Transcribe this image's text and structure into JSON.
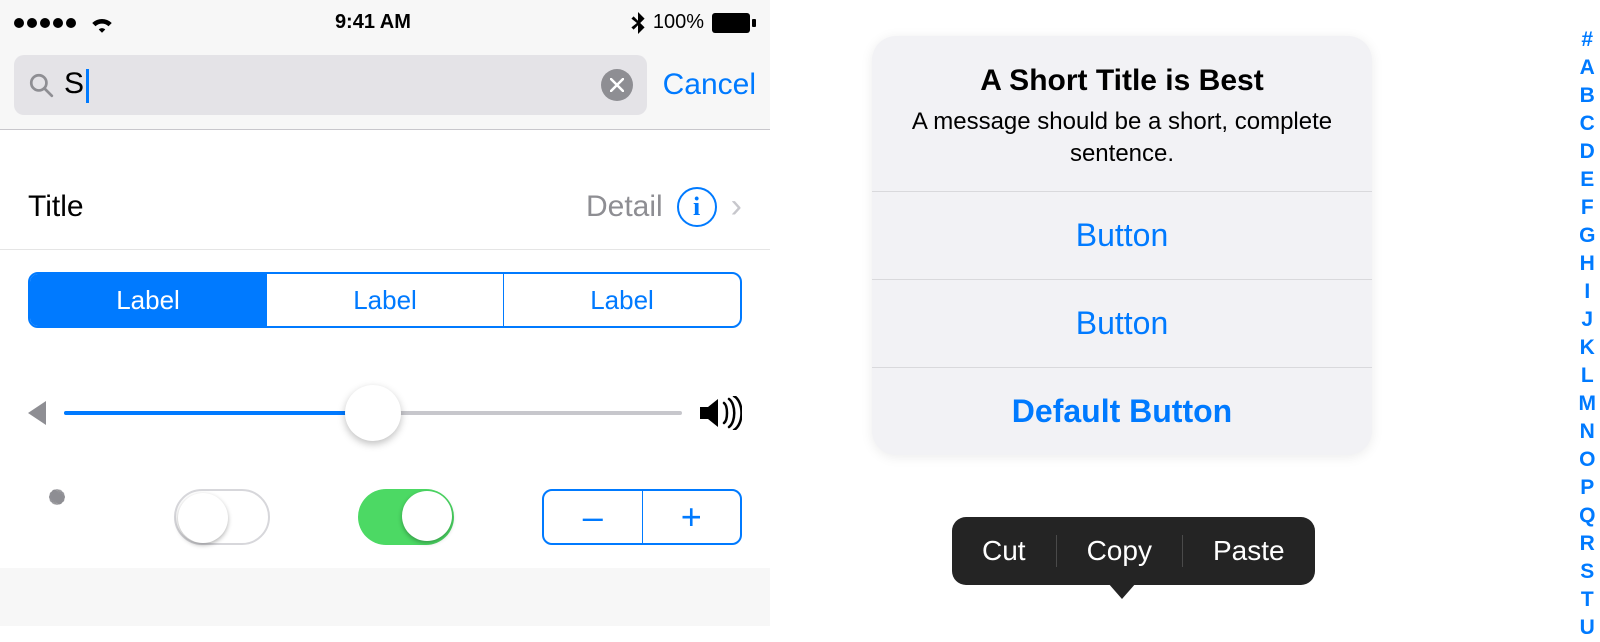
{
  "statusbar": {
    "time": "9:41 AM",
    "battery": "100%"
  },
  "search": {
    "query": "S",
    "cancel": "Cancel"
  },
  "list": {
    "title": "Title",
    "detail": "Detail"
  },
  "segments": [
    "Label",
    "Label",
    "Label"
  ],
  "stepper": {
    "minus": "–",
    "plus": "+"
  },
  "actionsheet": {
    "title": "A Short Title is Best",
    "message": "A message should be a short, complete sentence.",
    "buttons": [
      "Button",
      "Button"
    ],
    "default_button": "Default Button"
  },
  "menu": [
    "Cut",
    "Copy",
    "Paste"
  ],
  "index": [
    "#",
    "A",
    "B",
    "C",
    "D",
    "E",
    "F",
    "G",
    "H",
    "I",
    "J",
    "K",
    "L",
    "M",
    "N",
    "O",
    "P",
    "Q",
    "R",
    "S",
    "T",
    "U"
  ]
}
